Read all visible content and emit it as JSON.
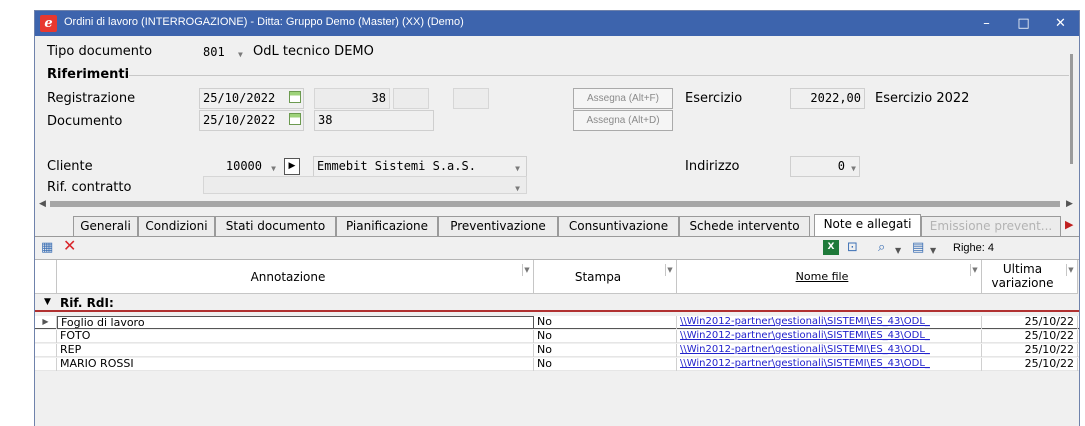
{
  "window": {
    "title": "Ordini di lavoro (INTERROGAZIONE) - Ditta: Gruppo Demo (Master) (XX) (Demo)",
    "minimize": "–",
    "maximize": "□",
    "close": "✕"
  },
  "header": {
    "tipo_documento_label": "Tipo documento",
    "tipo_documento_code": "801",
    "tipo_documento_desc": "OdL tecnico DEMO",
    "riferimenti_label": "Riferimenti",
    "registrazione_label": "Registrazione",
    "registrazione_data": "25/10/2022",
    "registrazione_numero": "38",
    "documento_label": "Documento",
    "documento_data": "25/10/2022",
    "documento_numero": "38",
    "assegna_reg": "Assegna (Alt+F)",
    "assegna_doc": "Assegna (Alt+D)",
    "esercizio_label": "Esercizio",
    "esercizio_value": "2022,00",
    "esercizio_desc": "Esercizio 2022",
    "cliente_label": "Cliente",
    "cliente_code": "10000",
    "cliente_nome": "Emmebit Sistemi S.a.S.",
    "indirizzo_label": "Indirizzo",
    "indirizzo_value": "0",
    "contratto_label": "Rif. contratto"
  },
  "tabs": [
    {
      "label": "Generali"
    },
    {
      "label": "Condizioni"
    },
    {
      "label": "Stati documento"
    },
    {
      "label": "Pianificazione"
    },
    {
      "label": "Preventivazione"
    },
    {
      "label": "Consuntivazione"
    },
    {
      "label": "Schede intervento"
    },
    {
      "label": "Note e allegati"
    },
    {
      "label": "Emissione prevent..."
    }
  ],
  "toolbar": {
    "righe_label": "Righe: 4"
  },
  "grid": {
    "columns": {
      "annotazione": "Annotazione",
      "stampa": "Stampa",
      "nome_file": "Nome file",
      "ultima_1": "Ultima",
      "ultima_2": "variazione"
    },
    "group": "Rif. RdI:",
    "rows": [
      {
        "annotazione": "Foglio di lavoro",
        "stampa": "No",
        "file": "\\\\Win2012-partner\\gestionali\\SISTEMI\\ES_43\\ODL_",
        "data": "25/10/22"
      },
      {
        "annotazione": "FOTO",
        "stampa": "No",
        "file": "\\\\Win2012-partner\\gestionali\\SISTEMI\\ES_43\\ODL_",
        "data": "25/10/22"
      },
      {
        "annotazione": "REP",
        "stampa": "No",
        "file": "\\\\Win2012-partner\\gestionali\\SISTEMI\\ES_43\\ODL_",
        "data": "25/10/22"
      },
      {
        "annotazione": "MARIO ROSSI",
        "stampa": "No",
        "file": "\\\\Win2012-partner\\gestionali\\SISTEMI\\ES_43\\ODL_",
        "data": "25/10/22"
      }
    ]
  }
}
